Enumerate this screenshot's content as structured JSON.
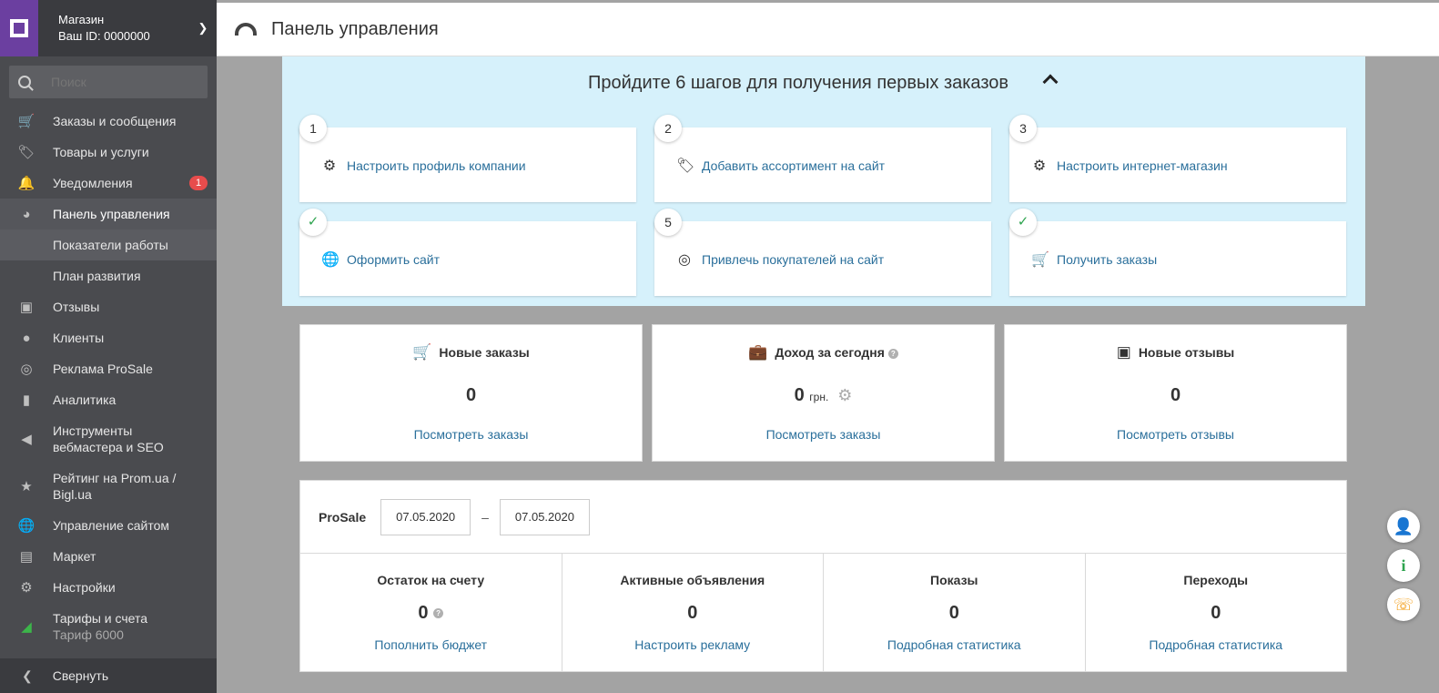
{
  "shop": {
    "name": "Магазин",
    "id": "Ваш ID: 0000000"
  },
  "search": {
    "placeholder": "Поиск"
  },
  "sidebar": {
    "items": [
      {
        "label": "Заказы и сообщения",
        "icon": "cart-icon"
      },
      {
        "label": "Товары и услуги",
        "icon": "tag-icon"
      },
      {
        "label": "Уведомления",
        "icon": "bell-icon",
        "badge": "1"
      },
      {
        "label": "Панель управления",
        "icon": "gauge-icon"
      },
      {
        "label": "Показатели работы"
      },
      {
        "label": "План развития"
      },
      {
        "label": "Отзывы",
        "icon": "comment-icon"
      },
      {
        "label": "Клиенты",
        "icon": "users-icon"
      },
      {
        "label": "Реклама ProSale",
        "icon": "target-icon"
      },
      {
        "label": "Аналитика",
        "icon": "bar-chart-icon"
      },
      {
        "label1": "Инструменты",
        "label2": "вебмастера и SEO",
        "icon": "megaphone-icon"
      },
      {
        "label1": "Рейтинг на Prom.ua /",
        "label2": "Bigl.ua",
        "icon": "rating-icon"
      },
      {
        "label": "Управление сайтом",
        "icon": "globe-icon"
      },
      {
        "label": "Маркет",
        "icon": "store-icon"
      },
      {
        "label": "Настройки",
        "icon": "gear-icon"
      },
      {
        "label1": "Тарифы и счета",
        "label2": "Тариф 6000",
        "icon": "tariff-icon"
      }
    ],
    "collapse": "Свернуть"
  },
  "header": {
    "title": "Панель управления"
  },
  "steps": {
    "title": "Пройдите 6 шагов для получения первых заказов",
    "items": [
      {
        "num": "1",
        "label": "Настроить профиль компании"
      },
      {
        "num": "2",
        "label": "Добавить ассортимент на сайт"
      },
      {
        "num": "3",
        "label": "Настроить интернет-магазин"
      },
      {
        "num": "✓",
        "label": "Оформить сайт"
      },
      {
        "num": "5",
        "label": "Привлечь покупателей на сайт"
      },
      {
        "num": "✓",
        "label": "Получить заказы"
      }
    ]
  },
  "cards": [
    {
      "title": "Новые заказы",
      "value": "0",
      "link": "Посмотреть заказы"
    },
    {
      "title": "Доход за сегодня",
      "value": "0",
      "unit": "грн.",
      "link": "Посмотреть заказы"
    },
    {
      "title": "Новые отзывы",
      "value": "0",
      "link": "Посмотреть отзывы"
    }
  ],
  "prosale": {
    "title": "ProSale",
    "date_from": "07.05.2020",
    "date_sep": "–",
    "date_to": "07.05.2020",
    "cols": [
      {
        "title": "Остаток на счету",
        "value": "0",
        "link": "Пополнить бюджет"
      },
      {
        "title": "Активные объявления",
        "value": "0",
        "link": "Настроить рекламу"
      },
      {
        "title": "Показы",
        "value": "0",
        "link": "Подробная статистика"
      },
      {
        "title": "Переходы",
        "value": "0",
        "link": "Подробная статистика"
      }
    ]
  },
  "colors": {
    "sidebar": "#4a4b4f",
    "accent": "#6b3fa0",
    "link": "#2a6f9b",
    "steps_bg": "#d6f1fb",
    "badge": "#e74c4c"
  }
}
